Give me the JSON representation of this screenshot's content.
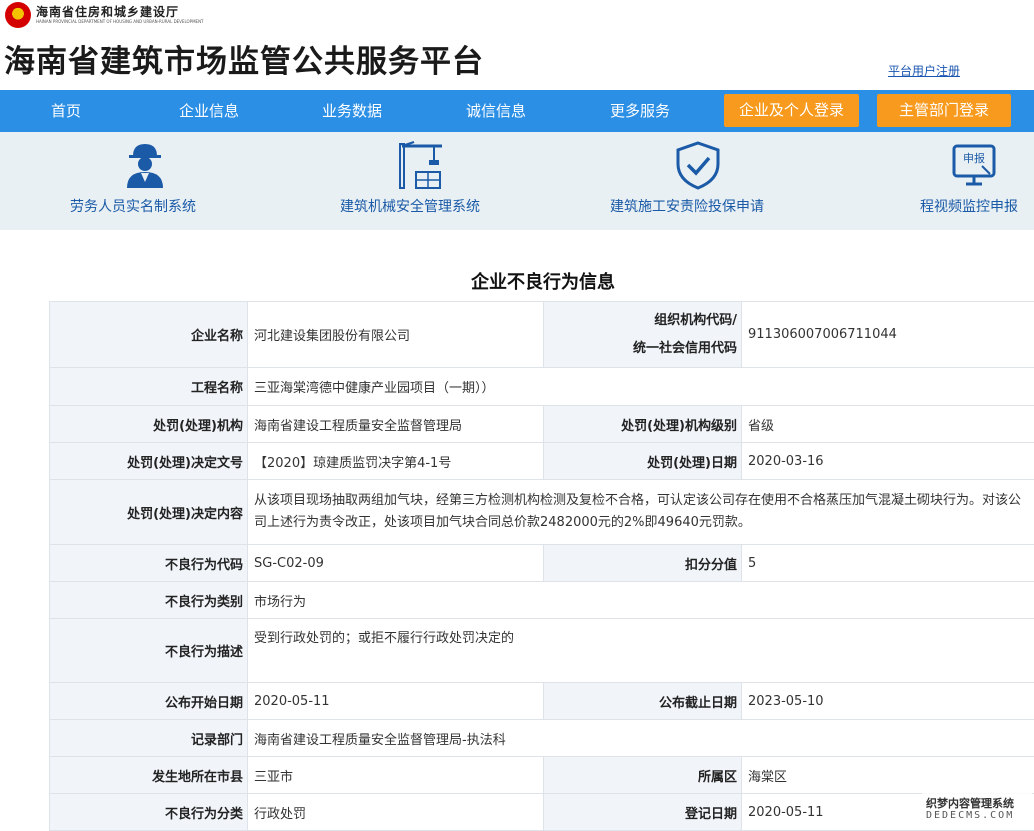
{
  "header": {
    "dept_name": "海南省住房和城乡建设厅",
    "dept_en": "HAINAN PROVINCIAL DEPARTMENT OF HOUSING AND URBAN-RURAL DEVELOPMENT",
    "site_title": "海南省建筑市场监管公共服务平台",
    "register_link": "平台用户注册"
  },
  "nav": {
    "items": [
      "首页",
      "企业信息",
      "业务数据",
      "诚信信息",
      "更多服务"
    ],
    "login_enterprise": "企业及个人登录",
    "login_admin": "主管部门登录"
  },
  "quick_links": [
    {
      "label": "劳务人员实名制系统",
      "icon": "worker-icon"
    },
    {
      "label": "建筑机械安全管理系统",
      "icon": "crane-icon"
    },
    {
      "label": "建筑施工安责险投保申请",
      "icon": "shield-check-icon"
    },
    {
      "label": "程视频监控申报",
      "icon": "report-icon",
      "icon_text": "申报"
    }
  ],
  "page_title": "企业不良行为信息",
  "record": {
    "company_name_label": "企业名称",
    "company_name": "河北建设集团股份有限公司",
    "org_code_label_1": "组织机构代码/",
    "org_code_label_2": "统一社会信用代码",
    "org_code": "911306007006711044",
    "project_label": "工程名称",
    "project": "三亚海棠湾德中健康产业园项目（一期））",
    "penalty_org_label": "处罚(处理)机构",
    "penalty_org": "海南省建设工程质量安全监督管理局",
    "penalty_level_label": "处罚(处理)机构级别",
    "penalty_level": "省级",
    "doc_no_label": "处罚(处理)决定文号",
    "doc_no": "【2020】琼建质监罚决字第4-1号",
    "penalty_date_label": "处罚(处理)日期",
    "penalty_date": "2020-03-16",
    "content_label": "处罚(处理)决定内容",
    "content": "从该项目现场抽取两组加气块，经第三方检测机构检测及复检不合格，可认定该公司存在使用不合格蒸压加气混凝土砌块行为。对该公司上述行为责令改正，处该项目加气块合同总价款2482000元的2%即49640元罚款。",
    "code_label": "不良行为代码",
    "code": "SG-C02-09",
    "score_label": "扣分分值",
    "score": "5",
    "category_label": "不良行为类别",
    "category": "市场行为",
    "desc_label": "不良行为描述",
    "desc": "受到行政处罚的；或拒不履行行政处罚决定的",
    "pub_start_label": "公布开始日期",
    "pub_start": "2020-05-11",
    "pub_end_label": "公布截止日期",
    "pub_end": "2023-05-10",
    "record_dept_label": "记录部门",
    "record_dept": "海南省建设工程质量安全监督管理局-执法科",
    "city_label": "发生地所在市县",
    "city": "三亚市",
    "district_label": "所属区",
    "district": "海棠区",
    "classify_label": "不良行为分类",
    "classify": "行政处罚",
    "reg_date_label": "登记日期",
    "reg_date": "2020-05-11"
  },
  "watermark": {
    "line1": "织梦内容管理系统",
    "line2": "DEDECMS.COM"
  },
  "colors": {
    "nav_bg": "#2b8fe6",
    "login_btn": "#f79a1e",
    "quick_bar_bg": "#e9f0f4",
    "link_blue": "#1a5aa6"
  }
}
